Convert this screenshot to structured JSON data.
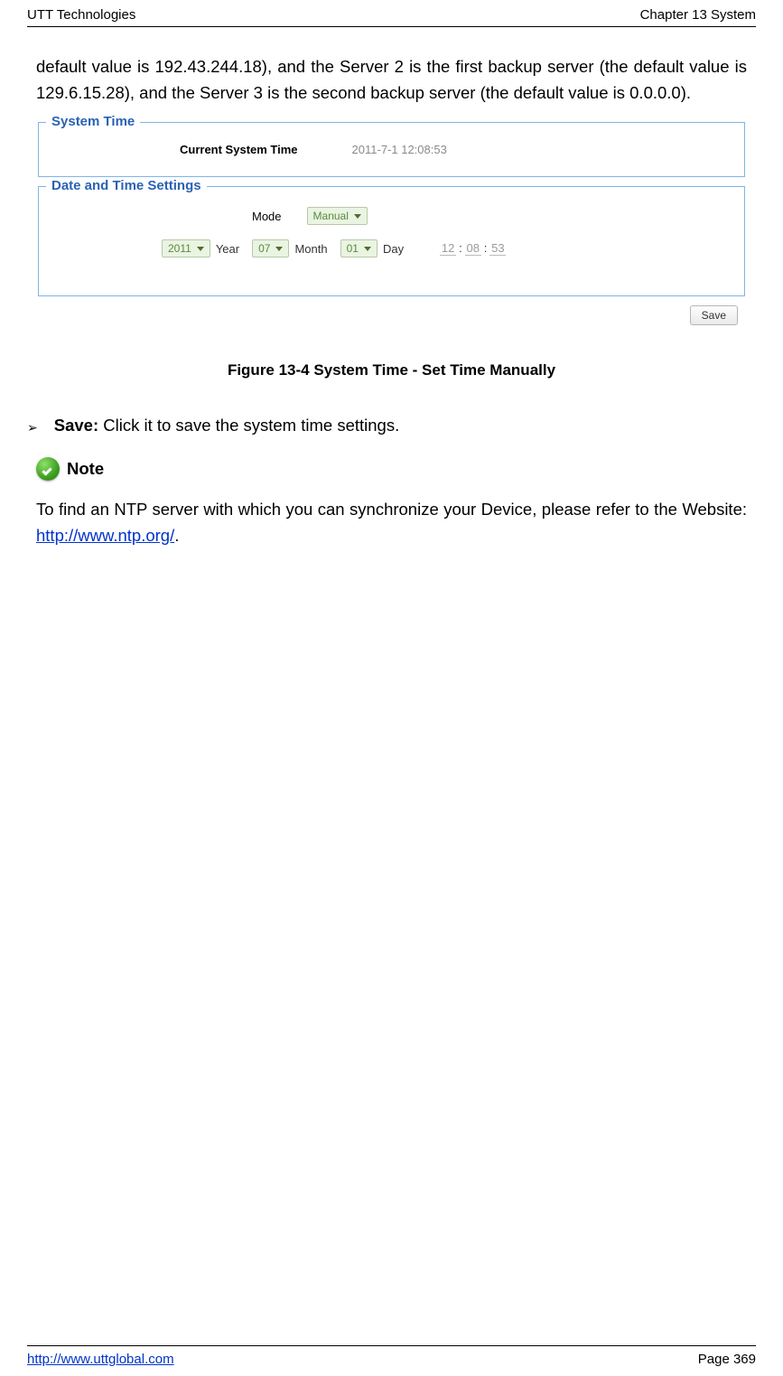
{
  "header": {
    "left": "UTT Technologies",
    "right": "Chapter 13 System"
  },
  "intro_paragraph": "default value is 192.43.244.18), and the Server 2 is the first backup server (the default value is 129.6.15.28), and the Server 3 is the second backup server (the default value is 0.0.0.0).",
  "system_time_panel": {
    "legend": "System Time",
    "label": "Current System Time",
    "value": "2011-7-1 12:08:53"
  },
  "date_time_panel": {
    "legend": "Date and Time Settings",
    "mode_label": "Mode",
    "mode_value": "Manual",
    "year_value": "2011",
    "year_label": "Year",
    "month_value": "07",
    "month_label": "Month",
    "day_value": "01",
    "day_label": "Day",
    "time_hh": "12",
    "time_mm": "08",
    "time_ss": "53"
  },
  "save_button_label": "Save",
  "figure_caption": "Figure 13-4 System Time - Set Time Manually",
  "save_bullet": {
    "label": "Save:",
    "text": " Click it to save the system time settings."
  },
  "note": {
    "label": "Note",
    "body_pre": "To find an NTP server with which you can synchronize your Device, please refer to the Website: ",
    "link_text": "http://www.ntp.org/",
    "body_post": "."
  },
  "footer": {
    "link": "http://www.uttglobal.com",
    "page": "Page 369"
  }
}
